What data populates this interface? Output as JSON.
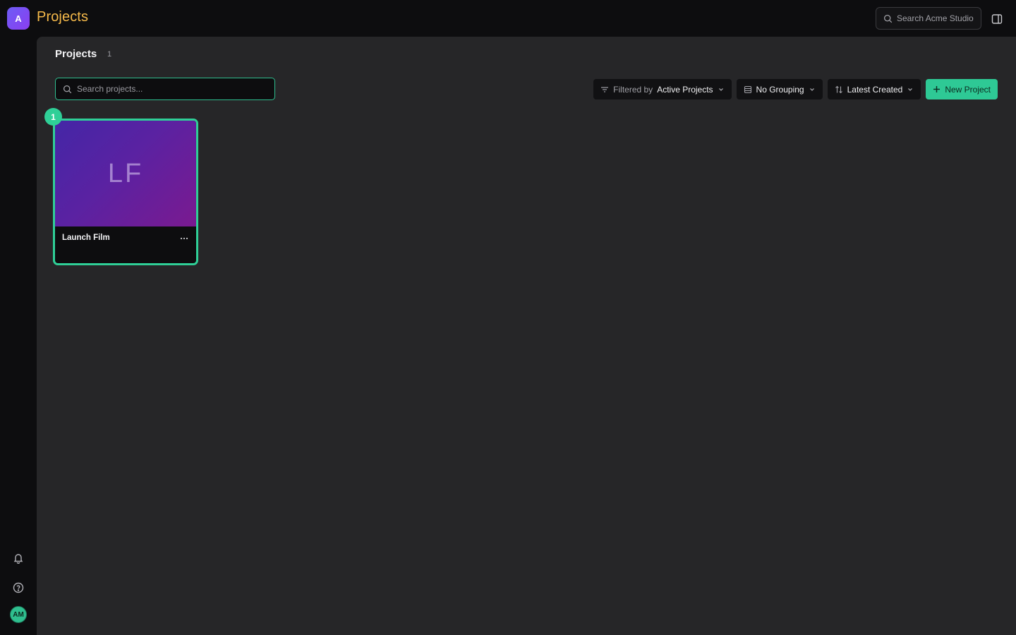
{
  "header": {
    "workspace_initial": "A",
    "title": "Projects",
    "search_placeholder": "Search Acme Studio",
    "icons": [
      "search-icon",
      "panel-toggle-icon"
    ]
  },
  "rail": {
    "icons": [
      "bell-icon",
      "help-icon"
    ],
    "user_initials": "AM"
  },
  "main": {
    "title": "Projects",
    "count": "1",
    "search_placeholder": "Search projects...",
    "toolbar": {
      "filter_prefix": "Filtered by",
      "filter_value": "Active Projects",
      "grouping": "No Grouping",
      "sort": "Latest Created",
      "new_project": "New Project"
    },
    "projects": [
      {
        "initials": "LF",
        "name": "Launch Film",
        "badge": "1",
        "selected": true
      }
    ]
  },
  "colors": {
    "accent": "#2fcf97",
    "heading": "#f5b94a",
    "panel": "#262628",
    "background": "#0d0d0f"
  }
}
